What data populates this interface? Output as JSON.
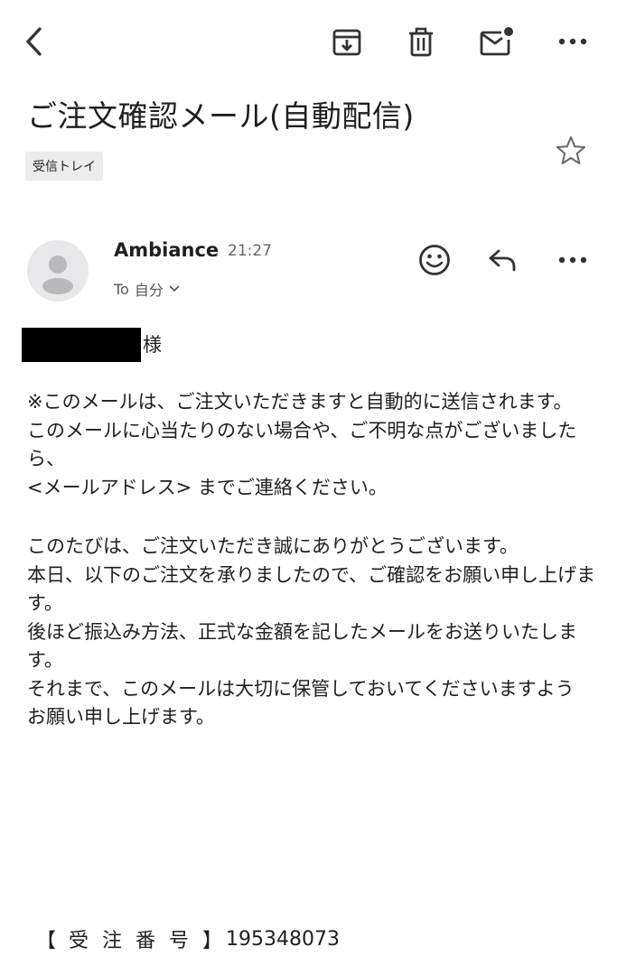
{
  "toolbar": {
    "back_icon": "chevron-left-icon",
    "archive_icon": "archive-icon",
    "delete_icon": "trash-icon",
    "mark_unread_icon": "mark-unread-icon",
    "more_icon": "more-horizontal-icon"
  },
  "email": {
    "subject": "ご注文確認メール(自動配信)",
    "label": "受信トレイ",
    "sender_name": "Ambiance",
    "time": "21:27",
    "to_prefix": "To",
    "to_value": "自分",
    "salutation_suffix": "様",
    "body_lines": [
      "※このメールは、ご注文いただきますと自動的に送信されます。",
      "このメールに心当たりのない場合や、ご不明な点がございましたら、",
      "<メールアドレス> までご連絡ください。",
      "",
      "このたびは、ご注文いただき誠にありがとうございます。",
      "本日、以下のご注文を承りましたので、ご確認をお願い申し上げます。",
      "後ほど振込み方法、正式な金額を記したメールをお送りいたします。",
      "それまで、このメールは大切に保管しておいてくださいますよう",
      "お願い申し上げます。"
    ],
    "order_label_open": "【",
    "order_label": "受注番号",
    "order_label_close": "】",
    "order_number": "195348073"
  }
}
